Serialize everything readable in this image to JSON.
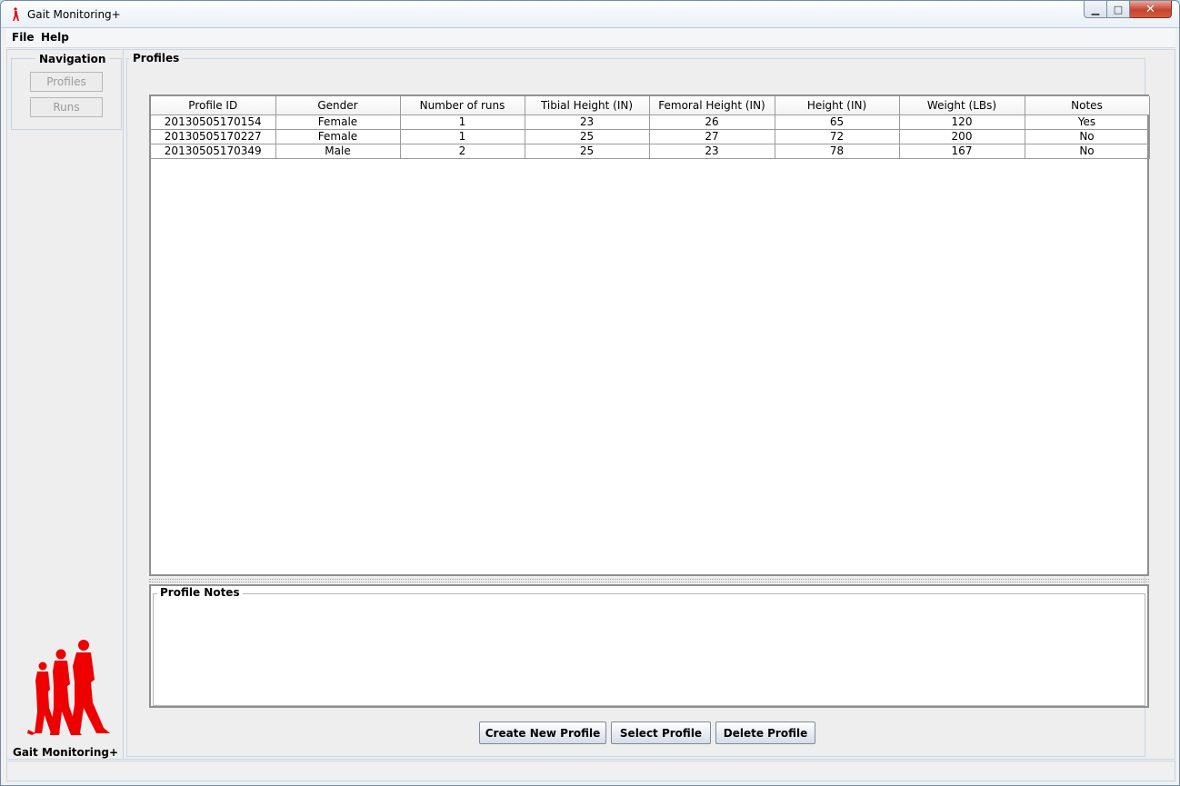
{
  "window": {
    "title": "Gait Monitoring+",
    "minimize_glyph": "▁",
    "maximize_glyph": "□",
    "close_glyph": "✕"
  },
  "menu": {
    "items": [
      "File",
      "Help"
    ]
  },
  "navigation": {
    "title": "Navigation",
    "buttons": [
      "Profiles",
      "Runs"
    ]
  },
  "branding": {
    "label": "Gait Monitoring+",
    "accent_color": "#ee0000",
    "logo_icon": "walking-people-icon"
  },
  "profiles": {
    "title": "Profiles",
    "columns": [
      "Profile ID",
      "Gender",
      "Number of runs",
      "Tibial Height (IN)",
      "Femoral Height (IN)",
      "Height (IN)",
      "Weight (LBs)",
      "Notes"
    ],
    "rows": [
      [
        "20130505170154",
        "Female",
        "1",
        "23",
        "26",
        "65",
        "120",
        "Yes"
      ],
      [
        "20130505170227",
        "Female",
        "1",
        "25",
        "27",
        "72",
        "200",
        "No"
      ],
      [
        "20130505170349",
        "Male",
        "2",
        "25",
        "23",
        "78",
        "167",
        "No"
      ]
    ]
  },
  "profile_notes": {
    "title": "Profile Notes",
    "text": ""
  },
  "actions": {
    "create_label": "Create New Profile",
    "select_label": "Select Profile",
    "delete_label": "Delete Profile"
  }
}
